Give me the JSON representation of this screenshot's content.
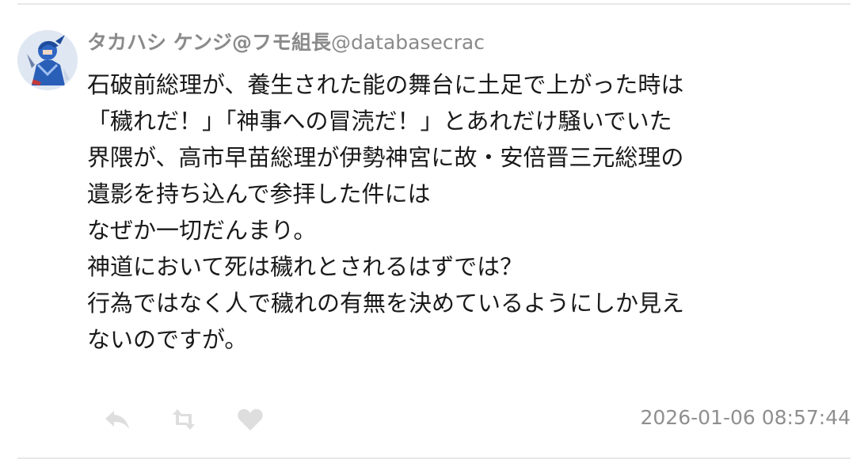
{
  "post": {
    "author": {
      "display_name": "タカハシ ケンジ@フモ組長",
      "handle": "@databasecrac"
    },
    "text_lines": [
      "石破前総理が、養生された能の舞台に土足で上がった時は",
      "「穢れだ！」「神事への冒涜だ！」とあれだけ騒いでいた",
      "界隈が、高市早苗総理が伊勢神宮に故・安倍晋三元総理の",
      "遺影を持ち込んで参拝した件には",
      "なぜか一切だんまり。",
      "神道において死は穢れとされるはずでは？",
      "行為ではなく人で穢れの有無を決めているようにしか見え",
      "ないのですが。"
    ],
    "timestamp": "2026-01-06 08:57:44",
    "actions": [
      {
        "name": "reply",
        "icon": "reply-icon"
      },
      {
        "name": "retweet",
        "icon": "retweet-icon"
      },
      {
        "name": "like",
        "icon": "heart-icon"
      }
    ]
  },
  "colors": {
    "meta_text": "#8a8a8a",
    "body_text": "#1a1a1a",
    "icon": "#dedede",
    "divider": "#e8e8e8"
  }
}
